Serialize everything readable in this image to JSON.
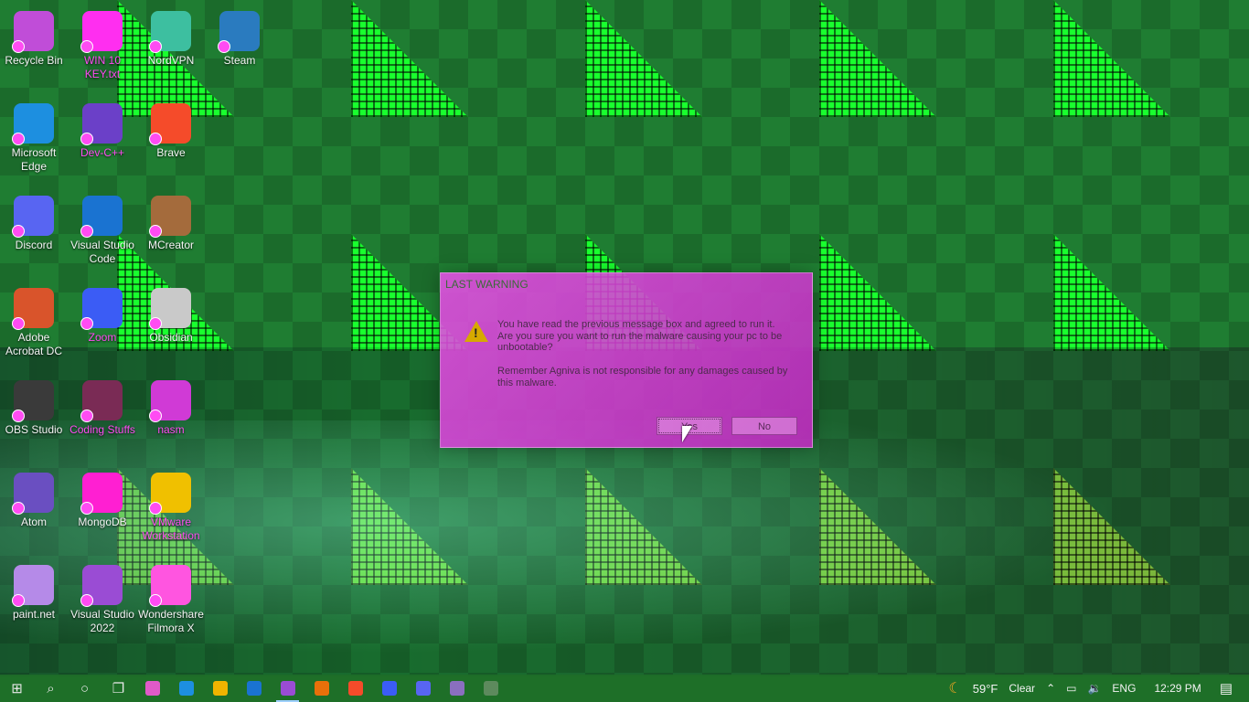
{
  "desktop_icons": [
    {
      "label": "Recycle Bin",
      "icon": "recycle-bin-icon",
      "color": "#c04dd8"
    },
    {
      "label": "Microsoft Edge",
      "icon": "edge-icon",
      "color": "#1d8fe0"
    },
    {
      "label": "Discord",
      "icon": "discord-icon",
      "color": "#5865f2"
    },
    {
      "label": "Adobe Acrobat DC",
      "icon": "acrobat-icon",
      "color": "#d9542b"
    },
    {
      "label": "OBS Studio",
      "icon": "obs-icon",
      "color": "#3a3a3a"
    },
    {
      "label": "Atom",
      "icon": "atom-icon",
      "color": "#6a4fc1"
    },
    {
      "label": "paint.net",
      "icon": "paintnet-icon",
      "color": "#b58ae8"
    },
    {
      "label": "WIN 10 KEY.txt",
      "icon": "text-file-icon",
      "color": "#ff2ef0"
    },
    {
      "label": "Dev-C++",
      "icon": "devcpp-icon",
      "color": "#6b40c8"
    },
    {
      "label": "Visual Studio Code",
      "icon": "vscode-icon",
      "color": "#1a73d1"
    },
    {
      "label": "Zoom",
      "icon": "zoom-icon",
      "color": "#3b5cf5"
    },
    {
      "label": "Coding Stuffs",
      "icon": "folder-chip-icon",
      "color": "#7a2b55"
    },
    {
      "label": "MongoDB",
      "icon": "mongodb-icon",
      "color": "#ff1fd2"
    },
    {
      "label": "Visual Studio 2022",
      "icon": "visual-studio-icon",
      "color": "#9a4cd4"
    },
    {
      "label": "NordVPN",
      "icon": "nordvpn-icon",
      "color": "#3dbfa0"
    },
    {
      "label": "Brave",
      "icon": "brave-icon",
      "color": "#f54b2a"
    },
    {
      "label": "MCreator",
      "icon": "mcreator-icon",
      "color": "#a46b3c"
    },
    {
      "label": "Obsidian",
      "icon": "obsidian-icon",
      "color": "#c9c9c9"
    },
    {
      "label": "nasm",
      "icon": "nasm-icon",
      "color": "#d03ad6"
    },
    {
      "label": "VMware Workstation",
      "icon": "vmware-icon",
      "color": "#f0c000"
    },
    {
      "label": "Wondershare Filmora X",
      "icon": "filmora-icon",
      "color": "#ff55e0"
    },
    {
      "label": "Steam",
      "icon": "steam-icon",
      "color": "#2a7bbf"
    }
  ],
  "dialog": {
    "title": "LAST WARNING",
    "message1": "You have read the previous message box and agreed to run it. Are you sure you want to run the malware causing your pc to be unbootable?",
    "message2": "Remember Agniva is not responsible for any damages caused by this malware.",
    "yes_label": "Yes",
    "no_label": "No"
  },
  "taskbar": {
    "pinned": [
      {
        "icon": "start-windows-icon",
        "glyph": "⊞"
      },
      {
        "icon": "search-icon",
        "glyph": "⌕"
      },
      {
        "icon": "cortana-icon",
        "glyph": "○"
      },
      {
        "icon": "task-view-icon",
        "glyph": "❐"
      },
      {
        "icon": "store-icon",
        "color": "#e05ac8"
      },
      {
        "icon": "edge-icon",
        "color": "#1d8fe0"
      },
      {
        "icon": "file-explorer-icon",
        "color": "#f0b400"
      },
      {
        "icon": "vscode-icon",
        "color": "#1a73d1"
      },
      {
        "icon": "visual-studio-icon",
        "color": "#9a4cd4",
        "active": true
      },
      {
        "icon": "office-icon",
        "color": "#e8700a"
      },
      {
        "icon": "brave-icon",
        "color": "#f54b2a"
      },
      {
        "icon": "zoom-icon",
        "color": "#3b5cf5"
      },
      {
        "icon": "discord-icon",
        "color": "#5865f2"
      },
      {
        "icon": "obsidian-icon",
        "color": "#8a6fbf"
      },
      {
        "icon": "console-icon",
        "color": "#5d8a5d"
      }
    ],
    "weather_temp": "59°F",
    "weather_desc": "Clear",
    "language": "ENG",
    "time": "12:29 PM"
  }
}
